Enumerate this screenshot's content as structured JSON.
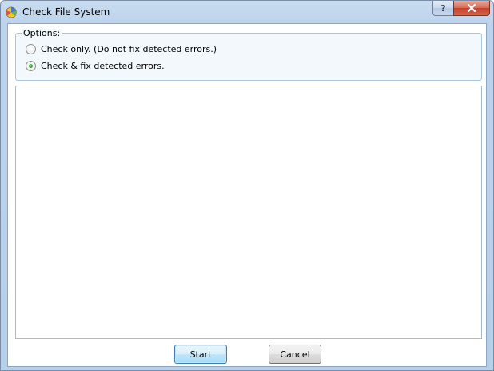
{
  "window": {
    "title": "Check File System",
    "app_icon": "pie-chart-app-icon",
    "help_label": "?",
    "help_icon": "help-icon",
    "close_icon": "close-icon"
  },
  "options": {
    "legend": "Options:",
    "items": [
      {
        "label": "Check only. (Do not fix detected errors.)",
        "selected": false
      },
      {
        "label": "Check & fix detected errors.",
        "selected": true
      }
    ]
  },
  "output": {
    "text": ""
  },
  "buttons": {
    "start_label": "Start",
    "cancel_label": "Cancel"
  },
  "colors": {
    "title_bar": "#bcd3ec",
    "close_button": "#c3402a",
    "group_border": "#a8c7de",
    "radio_dot": "#2f9a2f",
    "default_button_border": "#3c7fb1"
  }
}
